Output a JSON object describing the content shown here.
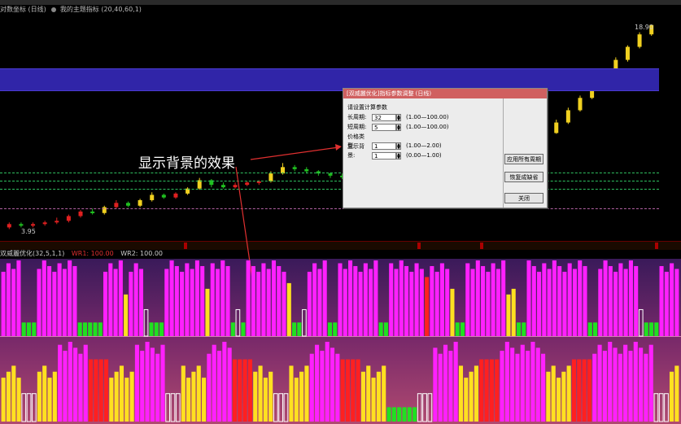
{
  "window": {
    "title_left": "对数坐标 (日线)",
    "title_mid": "我的主题指标 (20,40,60,1)",
    "menu_tabs": [
      "",
      "",
      "",
      "",
      "",
      "",
      "",
      "",
      "",
      "",
      "",
      ""
    ]
  },
  "main_chart": {
    "price_top_label": "18.90",
    "price_bottom_label": "3.95",
    "low_note": "显示背景的效果",
    "candles": [
      {
        "o": 3.6,
        "c": 3.7,
        "h": 3.75,
        "l": 3.55
      },
      {
        "o": 3.7,
        "c": 3.65,
        "h": 3.75,
        "l": 3.6
      },
      {
        "o": 3.65,
        "c": 3.7,
        "h": 3.75,
        "l": 3.6
      },
      {
        "o": 3.7,
        "c": 3.75,
        "h": 3.8,
        "l": 3.65
      },
      {
        "o": 3.75,
        "c": 3.8,
        "h": 3.9,
        "l": 3.7
      },
      {
        "o": 3.8,
        "c": 3.95,
        "h": 4.0,
        "l": 3.75
      },
      {
        "o": 3.95,
        "c": 4.1,
        "h": 4.15,
        "l": 3.9
      },
      {
        "o": 4.1,
        "c": 4.05,
        "h": 4.2,
        "l": 4.0
      },
      {
        "o": 4.05,
        "c": 4.25,
        "h": 4.3,
        "l": 4.0
      },
      {
        "o": 4.25,
        "c": 4.4,
        "h": 4.5,
        "l": 4.2
      },
      {
        "o": 4.4,
        "c": 4.3,
        "h": 4.45,
        "l": 4.25
      },
      {
        "o": 4.3,
        "c": 4.5,
        "h": 4.55,
        "l": 4.25
      },
      {
        "o": 4.5,
        "c": 4.7,
        "h": 4.8,
        "l": 4.45
      },
      {
        "o": 4.7,
        "c": 4.6,
        "h": 4.75,
        "l": 4.55
      },
      {
        "o": 4.6,
        "c": 4.75,
        "h": 4.8,
        "l": 4.55
      },
      {
        "o": 4.75,
        "c": 4.95,
        "h": 5.0,
        "l": 4.7
      },
      {
        "o": 4.95,
        "c": 5.3,
        "h": 5.4,
        "l": 4.9
      },
      {
        "o": 5.3,
        "c": 5.1,
        "h": 5.35,
        "l": 5.0
      },
      {
        "o": 5.1,
        "c": 5.0,
        "h": 5.2,
        "l": 4.95
      },
      {
        "o": 5.0,
        "c": 5.1,
        "h": 5.2,
        "l": 4.95
      },
      {
        "o": 5.1,
        "c": 5.2,
        "h": 5.25,
        "l": 5.05
      },
      {
        "o": 5.2,
        "c": 5.25,
        "h": 5.3,
        "l": 5.1
      },
      {
        "o": 5.25,
        "c": 5.6,
        "h": 5.7,
        "l": 5.2
      },
      {
        "o": 5.6,
        "c": 5.9,
        "h": 6.1,
        "l": 5.55
      },
      {
        "o": 5.9,
        "c": 5.8,
        "h": 6.0,
        "l": 5.7
      },
      {
        "o": 5.8,
        "c": 5.7,
        "h": 5.9,
        "l": 5.6
      },
      {
        "o": 5.7,
        "c": 5.6,
        "h": 5.75,
        "l": 5.5
      },
      {
        "o": 5.6,
        "c": 5.5,
        "h": 5.65,
        "l": 5.4
      },
      {
        "o": 5.5,
        "c": 5.45,
        "h": 5.6,
        "l": 5.35
      },
      {
        "o": 5.45,
        "c": 5.55,
        "h": 5.6,
        "l": 5.4
      },
      {
        "o": 5.55,
        "c": 5.5,
        "h": 5.6,
        "l": 5.45
      },
      {
        "o": 5.5,
        "c": 5.6,
        "h": 5.7,
        "l": 5.45
      },
      {
        "o": 5.6,
        "c": 5.8,
        "h": 5.85,
        "l": 5.55
      },
      {
        "o": 5.8,
        "c": 5.75,
        "h": 5.9,
        "l": 5.7
      },
      {
        "o": 5.75,
        "c": 6.0,
        "h": 6.1,
        "l": 5.7
      },
      {
        "o": 6.0,
        "c": 6.3,
        "h": 6.4,
        "l": 5.95
      },
      {
        "o": 6.3,
        "c": 6.6,
        "h": 6.8,
        "l": 6.2
      },
      {
        "o": 6.6,
        "c": 6.5,
        "h": 6.7,
        "l": 6.4
      },
      {
        "o": 6.6,
        "c": 6.5,
        "h": 6.7,
        "l": 6.4
      },
      {
        "o": 6.5,
        "c": 6.6,
        "h": 6.7,
        "l": 6.45
      },
      {
        "o": 6.6,
        "c": 6.55,
        "h": 6.7,
        "l": 6.5
      },
      {
        "o": 6.55,
        "c": 6.7,
        "h": 6.8,
        "l": 6.5
      },
      {
        "o": 6.7,
        "c": 6.9,
        "h": 7.0,
        "l": 6.6
      },
      {
        "o": 6.9,
        "c": 7.3,
        "h": 7.4,
        "l": 6.85
      },
      {
        "o": 7.3,
        "c": 7.2,
        "h": 7.4,
        "l": 7.1
      },
      {
        "o": 7.2,
        "c": 7.8,
        "h": 7.9,
        "l": 7.15
      },
      {
        "o": 7.8,
        "c": 8.5,
        "h": 8.7,
        "l": 7.75
      },
      {
        "o": 8.5,
        "c": 9.4,
        "h": 9.6,
        "l": 8.4
      },
      {
        "o": 9.4,
        "c": 10.4,
        "h": 10.6,
        "l": 9.3
      },
      {
        "o": 10.4,
        "c": 11.5,
        "h": 11.8,
        "l": 10.3
      },
      {
        "o": 11.5,
        "c": 12.8,
        "h": 13.0,
        "l": 11.4
      },
      {
        "o": 12.8,
        "c": 14.2,
        "h": 14.5,
        "l": 12.7
      },
      {
        "o": 14.2,
        "c": 15.8,
        "h": 16.0,
        "l": 14.0
      },
      {
        "o": 15.8,
        "c": 17.5,
        "h": 17.8,
        "l": 15.6
      },
      {
        "o": 17.5,
        "c": 18.9,
        "h": 18.9,
        "l": 17.3
      }
    ]
  },
  "axis_markers": [
    "",
    "",
    "",
    ""
  ],
  "indicator": {
    "name": "双威麗优化(32,5,1,1)",
    "wr1": "WR1: 100.00",
    "wr2": "WR2: 100.00"
  },
  "dialog": {
    "title": "[双威麗优化]指标参数调整 (日线)",
    "subtitle": "请设置计算参数",
    "rows": [
      {
        "label": "长周期:",
        "value": "32",
        "range": "(1.00—100.00)"
      },
      {
        "label": "短周期:",
        "value": "5",
        "range": "(1.00—100.00)"
      },
      {
        "label": "价格类型:",
        "value": "1",
        "range": "(1.00—2.00)"
      },
      {
        "label": "显示背景:",
        "value": "1",
        "range": "(0.00—1.00)"
      }
    ],
    "btn_apply": "应用所有周期",
    "btn_default": "恢复成缺省",
    "btn_close": "关闭"
  },
  "caption": "显示背景的效果",
  "colors": {
    "up": "#e02020",
    "down": "#20c020",
    "yellow_up": "#f0d020",
    "magenta": "#ff20ff",
    "red": "#ff2020",
    "yellow": "#ffe020",
    "green": "#20e020",
    "white": "#ffffff"
  },
  "bars_top": "mmmmgggmmmmmmmmgggggmmmmymmmwgggmmmmmmmmymmmmgwgmmmmmmmmyggwmmmmggmmmmmmmmggmmmmmmmrmmmmyggmmmmmmmmyyggmmmmmmmmmmmmggmmmmmmmmwgggmmmm",
  "bars_bottom": "yyyywwwyyyymmmmmmrrrryyyyymmmmmmwwwyyyyymmmmmrrrryyyywwwyyyymmmmmmrrrryyyyyggggggwwwmmmmmyyyyrrrrmmmmmmmmmyyyyyrrrrmmmmmmmmmmmmwwwyy"
}
